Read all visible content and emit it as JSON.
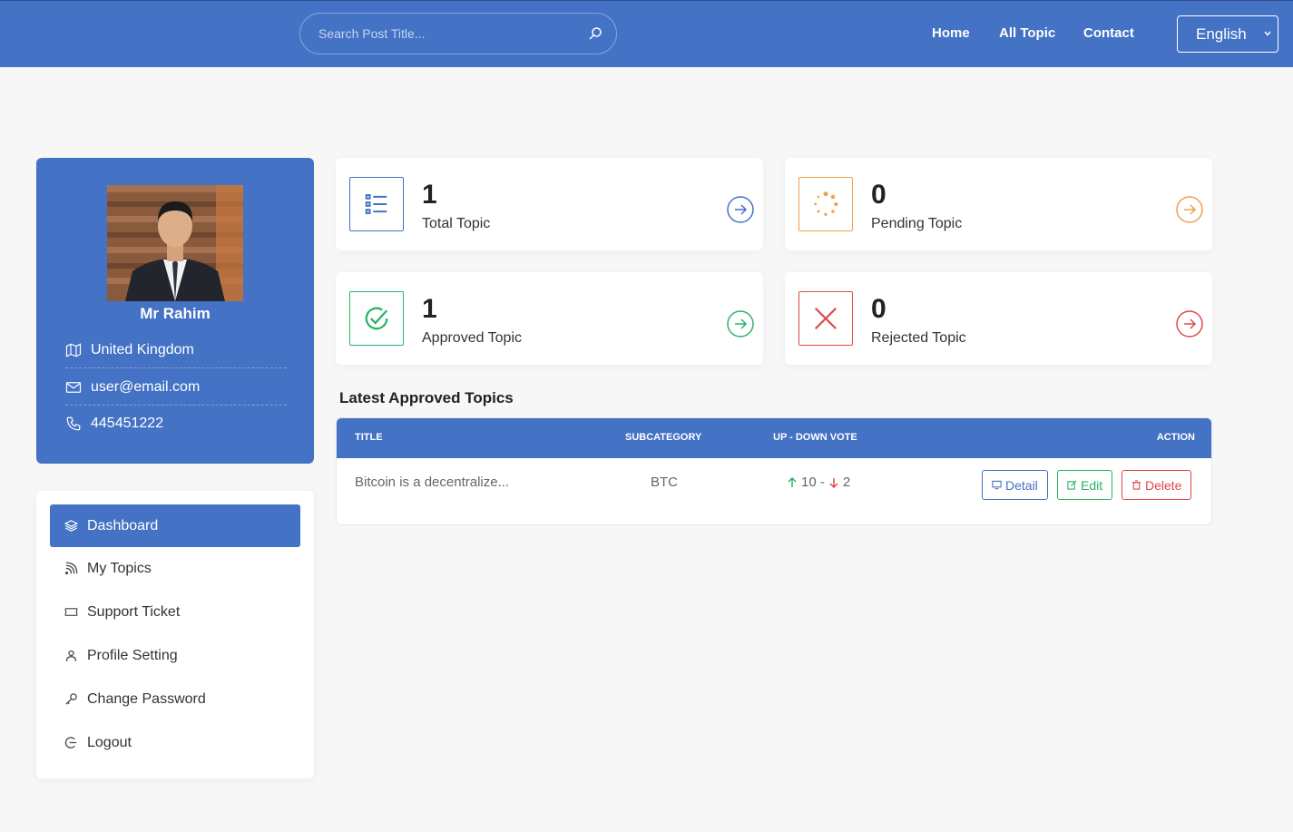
{
  "header": {
    "search_placeholder": "Search Post Title...",
    "nav": [
      "Home",
      "All Topic",
      "Contact"
    ],
    "language": "English"
  },
  "profile": {
    "name": "Mr Rahim",
    "country": "United Kingdom",
    "email": "user@email.com",
    "phone": "445451222"
  },
  "menu": {
    "items": [
      {
        "label": "Dashboard",
        "icon": "layers-icon",
        "active": true
      },
      {
        "label": "My Topics",
        "icon": "rss-icon",
        "active": false
      },
      {
        "label": "Support Ticket",
        "icon": "ticket-icon",
        "active": false
      },
      {
        "label": "Profile Setting",
        "icon": "user-icon",
        "active": false
      },
      {
        "label": "Change Password",
        "icon": "key-icon",
        "active": false
      },
      {
        "label": "Logout",
        "icon": "logout-icon",
        "active": false
      }
    ]
  },
  "stats": {
    "total": {
      "value": "1",
      "label": "Total Topic",
      "color": "#4472c4",
      "icon": "list-icon"
    },
    "pending": {
      "value": "0",
      "label": "Pending Topic",
      "color": "#f0a04b",
      "icon": "spinner-icon"
    },
    "approved": {
      "value": "1",
      "label": "Approved Topic",
      "color": "#28b463",
      "icon": "check-circle-icon"
    },
    "rejected": {
      "value": "0",
      "label": "Rejected Topic",
      "color": "#e04848",
      "icon": "x-icon"
    }
  },
  "latest": {
    "title": "Latest Approved Topics",
    "columns": [
      "Title",
      "Subcategory",
      "Up - Down Vote",
      "Action"
    ],
    "rows": [
      {
        "title": "Bitcoin is a decentralize...",
        "subcategory": "BTC",
        "up": "10 -",
        "down": "2"
      }
    ],
    "actions": {
      "detail": "Detail",
      "edit": "Edit",
      "delete": "Delete"
    }
  }
}
